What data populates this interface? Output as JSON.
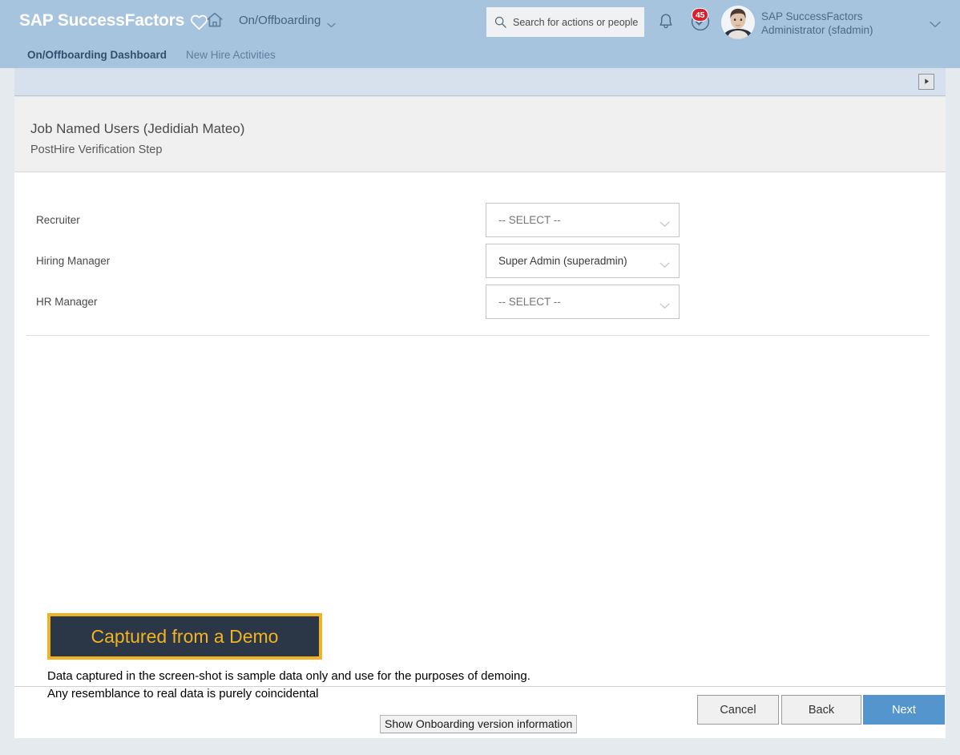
{
  "header": {
    "brand": "SAP SuccessFactors",
    "brand_icon": "heart-icon",
    "home_icon": "home-icon",
    "module": "On/Offboarding",
    "module_chevron_icon": "chevron-down-icon",
    "search": {
      "icon": "search-icon",
      "placeholder": "Search for actions or people",
      "value": ""
    },
    "notifications_icon": "bell-icon",
    "todo": {
      "icon": "check-circle-icon",
      "badge_count": "45",
      "badge_color": "#d91f2d"
    },
    "avatar": "avatar",
    "user_line1": "SAP SuccessFactors",
    "user_line2": "Administrator (sfadmin)",
    "user_chevron_icon": "chevron-down-icon",
    "bg_color": "#a7c4de"
  },
  "tabs": [
    {
      "label": "On/Offboarding Dashboard",
      "active": true
    },
    {
      "label": "New Hire Activities",
      "active": false
    }
  ],
  "subbar": {
    "expand_icon": "play-triangle-icon",
    "bg_color": "#d6e1ed"
  },
  "page": {
    "title": "Job Named Users (Jedidiah Mateo)",
    "subtitle": "PostHire Verification Step"
  },
  "form": {
    "fields": [
      {
        "label": "Recruiter",
        "value": "-- SELECT --",
        "filled": false,
        "chevron_icon": "chevron-down-icon"
      },
      {
        "label": "Hiring Manager",
        "value": "Super Admin (superadmin)",
        "filled": true,
        "chevron_icon": "chevron-down-icon"
      },
      {
        "label": "HR Manager",
        "value": "-- SELECT --",
        "filled": false,
        "chevron_icon": "chevron-down-icon"
      }
    ]
  },
  "demo_banner": {
    "text": "Captured from a Demo",
    "text_color": "#f0b323",
    "bg_color": "#2b3647",
    "border_color": "#f0b323"
  },
  "disclaimer": {
    "line1": "Data captured in the screen-shot is sample data only and use for the purposes of demoing.",
    "line2": "Any resemblance to real data is purely coincidental"
  },
  "footer": {
    "cancel_label": "Cancel",
    "back_label": "Back",
    "next_label": "Next",
    "next_color": "#5495cd",
    "version_link": "Show Onboarding version information"
  }
}
